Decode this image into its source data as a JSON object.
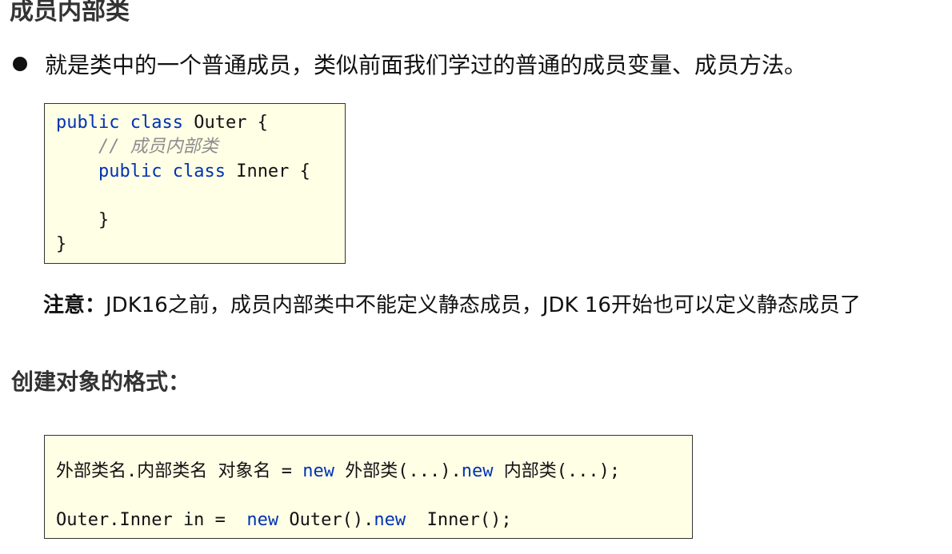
{
  "page": {
    "title": "成员内部类",
    "bullet": "就是类中的一个普通成员，类似前面我们学过的普通的成员变量、成员方法。",
    "code1": {
      "l1_kw1": "public",
      "l1_kw2": "class",
      "l1_rest": " Outer {",
      "l2_comment": "// 成员内部类",
      "l3_kw1": "public",
      "l3_kw2": "class",
      "l3_rest": " Inner {",
      "l5": "}",
      "l6": "}"
    },
    "note_label": "注意：",
    "note_text": "JDK16之前，成员内部类中不能定义静态成员，JDK 16开始也可以定义静态成员了",
    "subtitle": "创建对象的格式：",
    "code2": {
      "l1_a": "外部类名.内部类名 对象名 = ",
      "l1_kw1": "new",
      "l1_b": " 外部类(...).",
      "l1_kw2": "new",
      "l1_c": " 内部类(...);",
      "l2_a": "Outer.Inner in =  ",
      "l2_kw1": "new",
      "l2_b": " Outer().",
      "l2_kw2": "new",
      "l2_c": "  Inner();"
    }
  },
  "colors": {
    "keyword": "#0033b3",
    "comment": "#8c8c8c",
    "code_bg": "#ffffe6"
  }
}
